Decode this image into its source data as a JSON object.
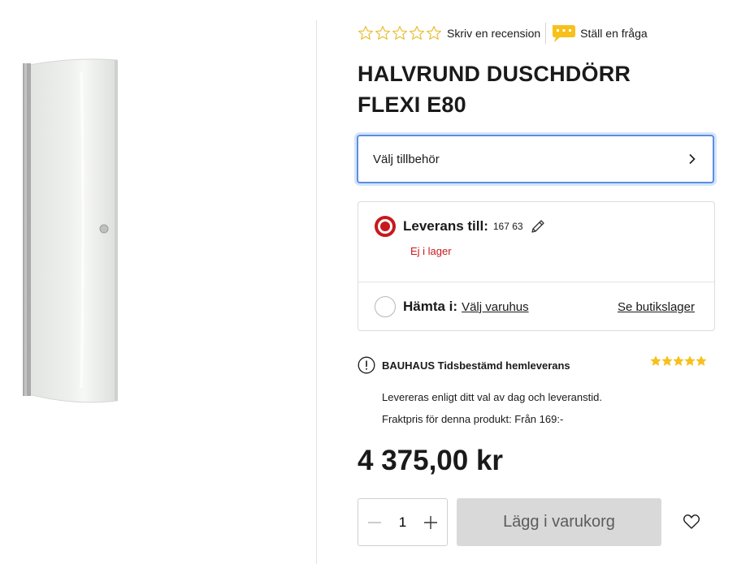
{
  "rating": {
    "review_label": "Skriv en recension",
    "question_label": "Ställ en fråga"
  },
  "product": {
    "title": "HALVRUND DUSCHDÖRR FLEXI E80",
    "price": "4 375,00 kr"
  },
  "accessories": {
    "label": "Välj tillbehör"
  },
  "delivery": {
    "home_label": "Leverans till:",
    "postal_code": "167 63",
    "stock_status": "Ej i lager",
    "pickup_label": "Hämta i:",
    "store_link": "Välj varuhus",
    "store_stock_link": "Se butikslager"
  },
  "home_delivery": {
    "title": "BAUHAUS Tidsbestämd hemleverans",
    "line1": "Levereras enligt ditt val av dag och leveranstid.",
    "line2": "Fraktpris för denna produkt: Från 169:-",
    "stars": 5
  },
  "cart": {
    "quantity": "1",
    "add_label": "Lägg i varukorg"
  },
  "colors": {
    "brand_red": "#c8191e",
    "focus_blue": "#5a8fe0",
    "star_yellow": "#f7c01b",
    "cart_button_bg": "#d9d9d9"
  }
}
